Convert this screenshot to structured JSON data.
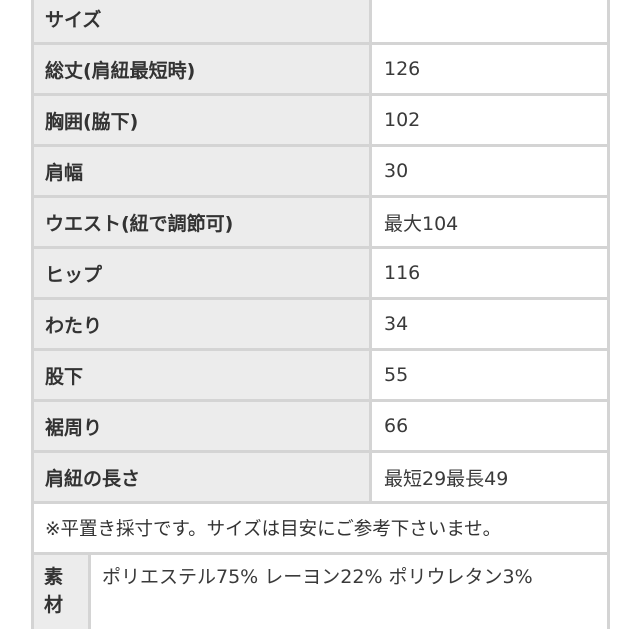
{
  "size_table": {
    "rows": [
      {
        "label": "サイズ",
        "value": ""
      },
      {
        "label": "総丈(肩紐最短時)",
        "value": "126"
      },
      {
        "label": "胸囲(脇下)",
        "value": "102"
      },
      {
        "label": "肩幅",
        "value": "30"
      },
      {
        "label": "ウエスト(紐で調節可)",
        "value": "最大104"
      },
      {
        "label": "ヒップ",
        "value": "116"
      },
      {
        "label": "わたり",
        "value": "34"
      },
      {
        "label": "股下",
        "value": "55"
      },
      {
        "label": "裾周り",
        "value": "66"
      },
      {
        "label": "肩紐の長さ",
        "value": "最短29最長49"
      }
    ],
    "note": "※平置き採寸です。サイズは目安にご参考下さいませ。"
  },
  "material": {
    "label": "素材",
    "value": "ポリエステル75% レーヨン22% ポリウレタン3%"
  }
}
